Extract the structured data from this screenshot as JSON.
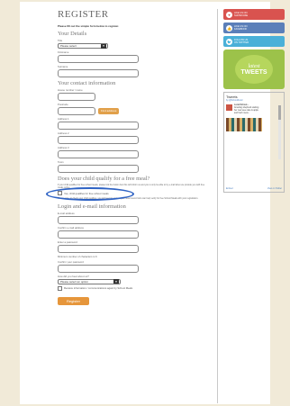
{
  "form": {
    "title": "REGISTER",
    "intro": "Please fill out the simple form below to register.",
    "section_details": "Your Details",
    "title_label": "Title",
    "title_select_value": "Please select",
    "firstname_label": "Firstname",
    "surname_label": "Surname",
    "section_contact": "Your contact information",
    "phone_label": "House number / name",
    "postcode_label": "Postcode",
    "find_address_button": "Find address",
    "address1_label": "Address 1",
    "address2_label": "Address 2",
    "address3_label": "Address 3",
    "town_label": "Town",
    "section_qualify": "Does your child qualify for a free meal?",
    "qualify_text": "If your child qualifies for free school meals, please tick the button box this will inform us and you to only be able to by e-mail when we provide you with free meals online.",
    "qualify_checkbox_label": "Yes, child qualifies for free school meals",
    "qualify_note": "Please note: to check your child qualifies, you will need to contact your local council who can help verify for free School Meals with your registration.",
    "section_login": "Login and e-mail information",
    "email_label": "E-mail address",
    "confirm_email_label": "Confirm e-mail address",
    "password_label": "Enter a password",
    "password_hint": "Minimum number of characters is 6",
    "confirm_password_label": "Confirm your password",
    "hear_label": "How did you hear about us?",
    "hear_select_value": "Please select an option",
    "newsletter_label": "Receive information / communications again by School Meals",
    "register_button": "Register"
  },
  "sidebar": {
    "social": [
      {
        "name": "like-us",
        "icon": "heart-icon",
        "line1": "LIKE US ON",
        "line2": "SHOWCASE",
        "color": "#d9534f",
        "icon_color": "#d9534f"
      },
      {
        "name": "facebook",
        "icon": "thumbs-up-icon",
        "line1": "LIKE US ON",
        "line2": "FACEBOOK",
        "color": "#5b7fb9",
        "icon_color": "#5b7fb9"
      },
      {
        "name": "twitter",
        "icon": "bird-icon",
        "line1": "FOLLOW US",
        "line2": "ON TWITTER",
        "color": "#4ab0d8",
        "icon_color": "#4ab0d8"
      }
    ],
    "latest": "latest",
    "tweets": "TWEETS",
    "feed_title": "Tweets",
    "feed_by": "by @SchoolFood",
    "tweet_user": "Local School...",
    "tweet_text": "Amazing shepherd starting her new wee cake & apple and fresh menu..",
    "feed_embed": "Embed",
    "feed_view": "View on Twitter"
  }
}
